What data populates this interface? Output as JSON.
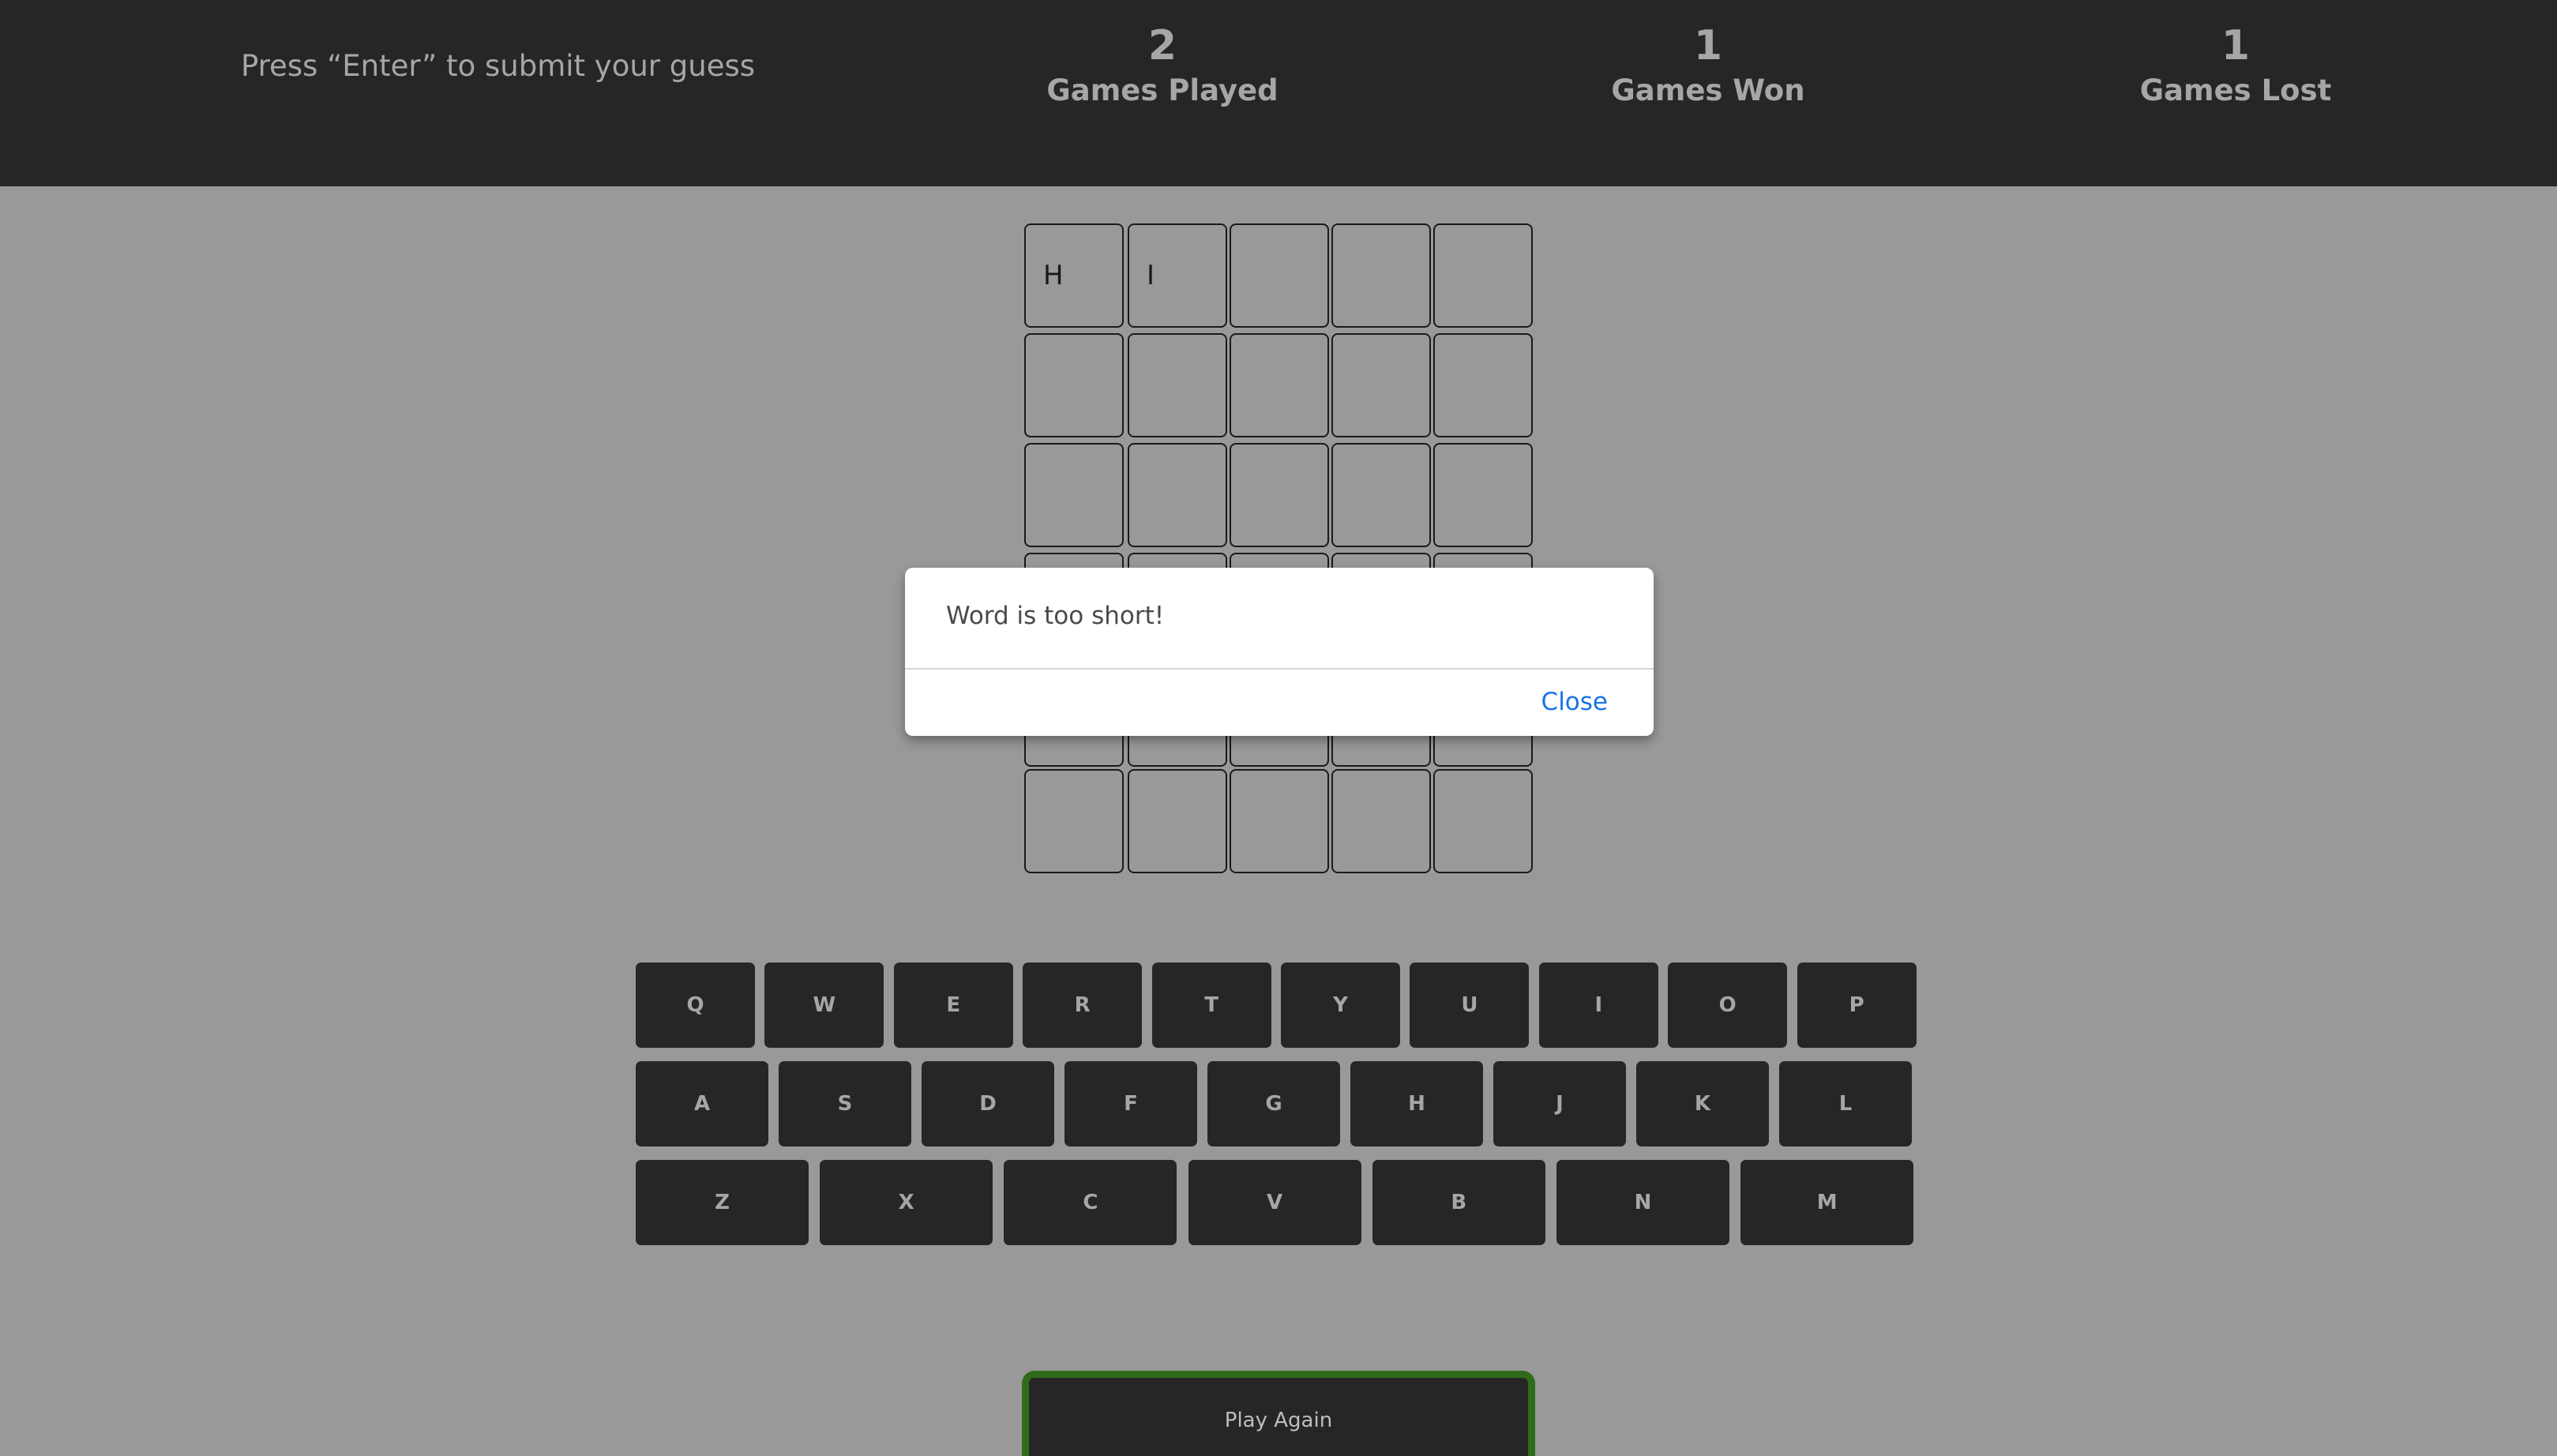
{
  "header": {
    "hint": "Press “Enter” to submit your guess",
    "stats": [
      {
        "value": "2",
        "label": "Games Played"
      },
      {
        "value": "1",
        "label": "Games Won"
      },
      {
        "value": "1",
        "label": "Games Lost"
      }
    ]
  },
  "board": {
    "rows": [
      [
        "H",
        "I",
        "",
        "",
        ""
      ],
      [
        "",
        "",
        "",
        "",
        ""
      ],
      [
        "",
        "",
        "",
        "",
        ""
      ],
      [
        "",
        "",
        "",
        "",
        ""
      ],
      [
        "",
        "",
        "",
        "",
        ""
      ],
      [
        "",
        "",
        "",
        "",
        ""
      ]
    ]
  },
  "keyboard": {
    "rows": [
      [
        "Q",
        "W",
        "E",
        "R",
        "T",
        "Y",
        "U",
        "I",
        "O",
        "P"
      ],
      [
        "A",
        "S",
        "D",
        "F",
        "G",
        "H",
        "J",
        "K",
        "L"
      ],
      [
        "Z",
        "X",
        "C",
        "V",
        "B",
        "N",
        "M"
      ]
    ]
  },
  "play_again_label": "Play Again",
  "dialog": {
    "message": "Word is too short!",
    "close_label": "Close"
  },
  "colors": {
    "page_background": "#999999",
    "header_background": "#262626",
    "key_background": "#262626",
    "play_again_border": "#2f6b1b",
    "dialog_link": "#1a73e8"
  }
}
